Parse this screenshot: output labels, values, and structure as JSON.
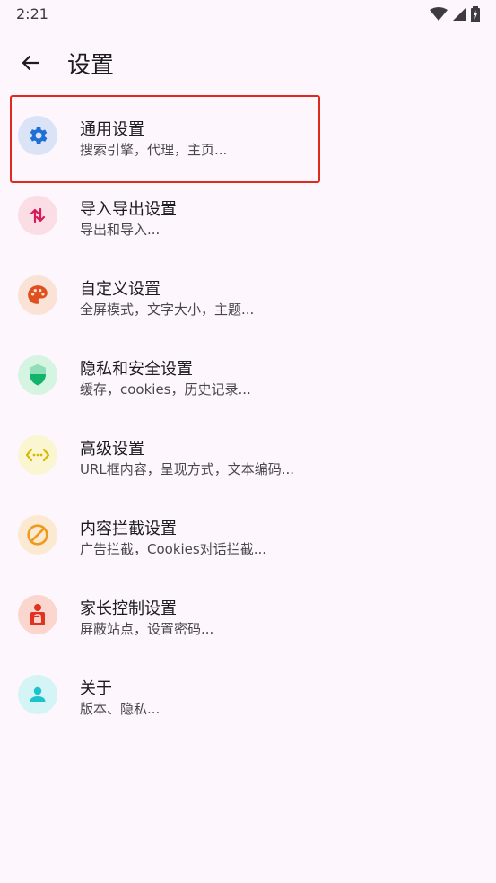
{
  "status_bar": {
    "time": "2:21"
  },
  "app_bar": {
    "title": "设置"
  },
  "items": [
    {
      "title": "通用设置",
      "subtitle": "搜索引擎，代理，主页...",
      "icon": "gear-icon",
      "icon_bg": "#dbe4f6",
      "icon_color": "#1f6fd6"
    },
    {
      "title": "导入导出设置",
      "subtitle": "导出和导入...",
      "icon": "import-export-icon",
      "icon_bg": "#fbdde6",
      "icon_color": "#d81b54"
    },
    {
      "title": "自定义设置",
      "subtitle": "全屏模式，文字大小，主题...",
      "icon": "palette-icon",
      "icon_bg": "#fbe2d7",
      "icon_color": "#e0501f"
    },
    {
      "title": "隐私和安全设置",
      "subtitle": "缓存，cookies，历史记录...",
      "icon": "shield-icon",
      "icon_bg": "#d5f4e2",
      "icon_color": "#12b36a"
    },
    {
      "title": "高级设置",
      "subtitle": "URL框内容，呈现方式，文本编码...",
      "icon": "code-icon",
      "icon_bg": "#faf6d2",
      "icon_color": "#dbb800"
    },
    {
      "title": "内容拦截设置",
      "subtitle": "广告拦截，Cookies对话拦截...",
      "icon": "block-icon",
      "icon_bg": "#fbe9d2",
      "icon_color": "#ee9a1c"
    },
    {
      "title": "家长控制设置",
      "subtitle": "屏蔽站点，设置密码...",
      "icon": "parental-lock-icon",
      "icon_bg": "#fbd6cf",
      "icon_color": "#e2321f"
    },
    {
      "title": "关于",
      "subtitle": "版本、隐私...",
      "icon": "person-icon",
      "icon_bg": "#d4f4f6",
      "icon_color": "#1cc3cf"
    }
  ],
  "colors": {
    "background": "#fdf7fd",
    "highlight": "#e0281c"
  }
}
